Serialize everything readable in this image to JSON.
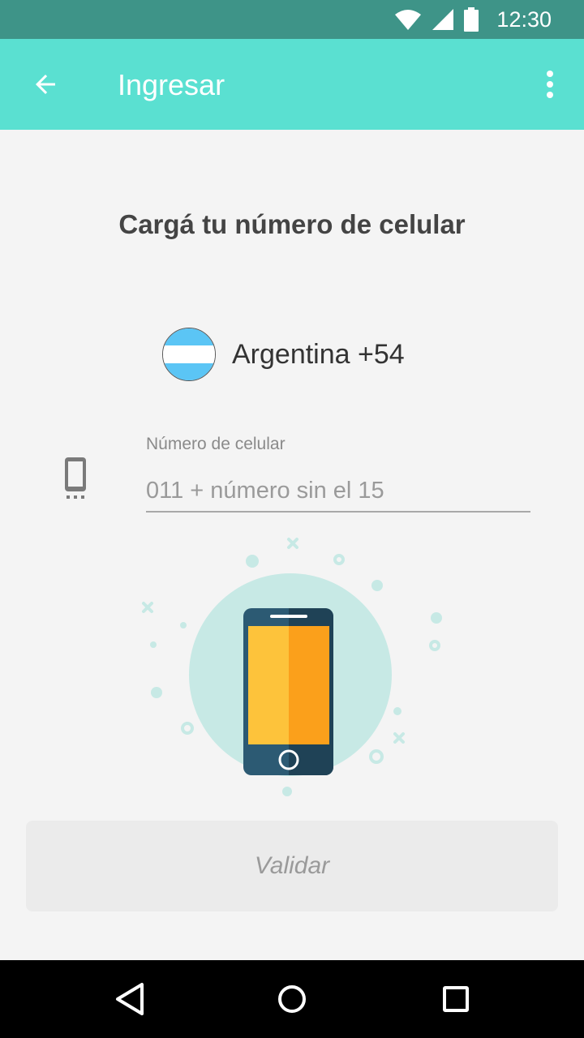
{
  "status_bar": {
    "time": "12:30",
    "icons": [
      "wifi-icon",
      "cell-signal-icon",
      "battery-icon"
    ],
    "background": "#3e9488"
  },
  "app_bar": {
    "title": "Ingresar",
    "back_icon": "arrow-back-icon",
    "menu_icon": "more-vert-icon",
    "background": "#5ae0d1"
  },
  "form": {
    "headline": "Cargá tu número de celular",
    "country": {
      "label": "Argentina +54",
      "flag_icon": "argentina-flag-icon"
    },
    "phone_field": {
      "label": "Número de celular",
      "placeholder": "011 + número sin el 15",
      "value": "",
      "icon": "smartphone-icon"
    },
    "illustration": "phone-illustration",
    "submit_label": "Validar"
  },
  "nav_bar": {
    "buttons": [
      "back-triangle-icon",
      "home-circle-icon",
      "recents-square-icon"
    ]
  },
  "colors": {
    "accent": "#5ae0d1",
    "status_bar": "#3e9488",
    "illustration_circle": "#c7e9e5",
    "phone_body": "#2c5a73",
    "screen_yellow": "#fdc33b",
    "screen_orange": "#fba01b"
  }
}
